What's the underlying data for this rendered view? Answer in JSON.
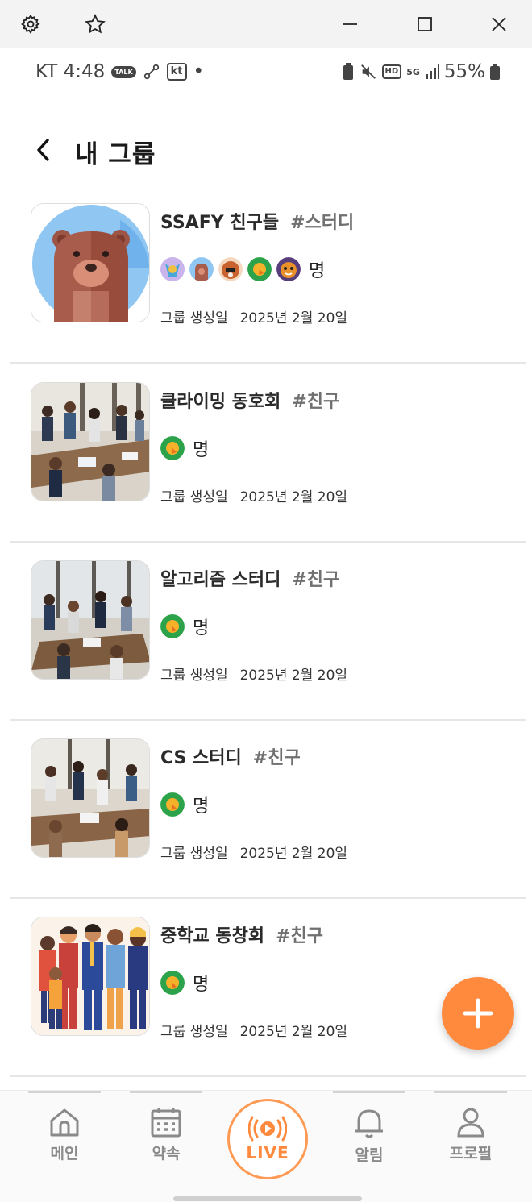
{
  "status_bar": {
    "carrier_time": "KT 4:48",
    "talk_label": "TALK",
    "kt_badge": "kt",
    "dot": "•",
    "hd_badge": "HD",
    "network": "5G",
    "battery_percent": "55%"
  },
  "header": {
    "back_icon": "chevron-left-icon",
    "title": "내 그룹"
  },
  "groups": [
    {
      "name": "SSAFY 친구들",
      "tag": "#스터디",
      "member_unit": "명",
      "date_label": "그룹 생성일",
      "date": "2025년 2월 20일",
      "thumbnail": "bear-avatar"
    },
    {
      "name": "클라이밍 동호회",
      "tag": "#친구",
      "member_unit": "명",
      "date_label": "그룹 생성일",
      "date": "2025년 2월 20일",
      "thumbnail": "office-meeting-photo"
    },
    {
      "name": "알고리즘 스터디",
      "tag": "#친구",
      "member_unit": "명",
      "date_label": "그룹 생성일",
      "date": "2025년 2월 20일",
      "thumbnail": "office-meeting-photo"
    },
    {
      "name": "CS 스터디",
      "tag": "#친구",
      "member_unit": "명",
      "date_label": "그룹 생성일",
      "date": "2025년 2월 20일",
      "thumbnail": "office-meeting-photo"
    },
    {
      "name": "중학교 동창회",
      "tag": "#친구",
      "member_unit": "명",
      "date_label": "그룹 생성일",
      "date": "2025년 2월 20일",
      "thumbnail": "people-illustration"
    }
  ],
  "fab": {
    "icon": "plus-icon"
  },
  "bottom_nav": {
    "home": "메인",
    "appointments": "약속",
    "live": "LIVE",
    "alerts": "알림",
    "profile": "프로필"
  },
  "colors": {
    "accent": "#ff8a3d",
    "nav_inactive": "#8a8a8a",
    "divider": "#e6e6e6"
  }
}
